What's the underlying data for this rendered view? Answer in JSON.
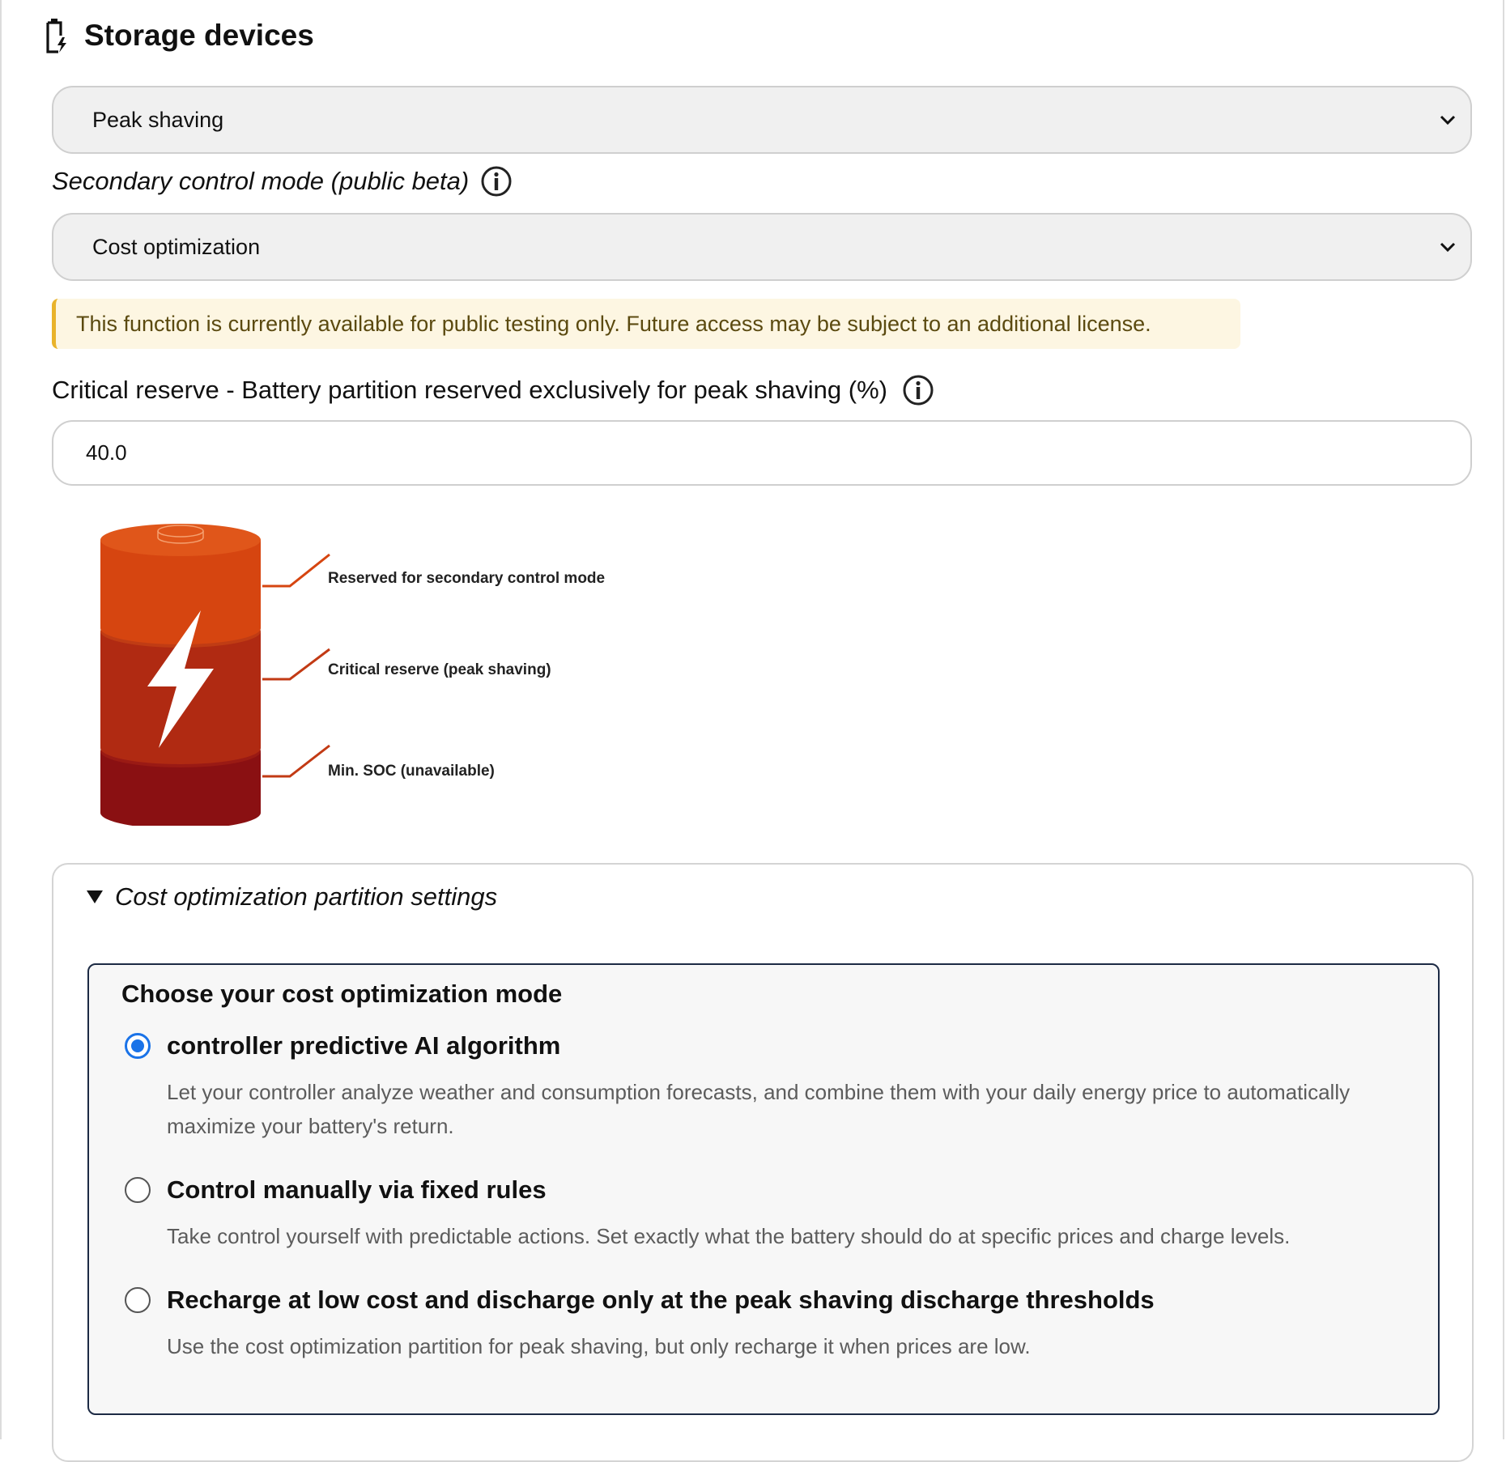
{
  "section": {
    "title": "Storage devices",
    "icon": "battery-charging-icon"
  },
  "primary_mode": {
    "selected": "Peak shaving"
  },
  "secondary_mode": {
    "label": "Secondary control mode (public beta)",
    "selected": "Cost optimization"
  },
  "beta_notice": {
    "text": "This function is currently available for public testing only. Future access may be subject to an additional license."
  },
  "critical_reserve": {
    "label": "Critical reserve - Battery partition reserved exclusively for peak shaving (%)",
    "value": "40.0"
  },
  "battery_diagram": {
    "segments": [
      {
        "label": "Reserved for secondary control mode",
        "color": "#d64510"
      },
      {
        "label": "Critical reserve (peak shaving)",
        "color": "#b02a12"
      },
      {
        "label": "Min. SOC (unavailable)",
        "color": "#8a1012"
      }
    ],
    "bolt_icon": "lightning-bolt-icon"
  },
  "partition_settings": {
    "summary": "Cost optimization partition settings",
    "expanded": true,
    "heading": "Choose your cost optimization mode",
    "options": [
      {
        "title": "controller predictive AI algorithm",
        "description": "Let your controller analyze weather and consumption forecasts, and combine them with your daily energy price to automatically maximize your battery's return.",
        "selected": true
      },
      {
        "title": "Control manually via fixed rules",
        "description": "Take control yourself with predictable actions. Set exactly what the battery should do at specific prices and charge levels.",
        "selected": false
      },
      {
        "title": "Recharge at low cost and discharge only at the peak shaving discharge thresholds",
        "description": "Use the cost optimization partition for peak shaving, but only recharge it when prices are low.",
        "selected": false
      }
    ]
  },
  "colors": {
    "accent": "#1a73e8",
    "notice_border": "#e9b32b",
    "notice_bg": "#fdf6e2"
  }
}
